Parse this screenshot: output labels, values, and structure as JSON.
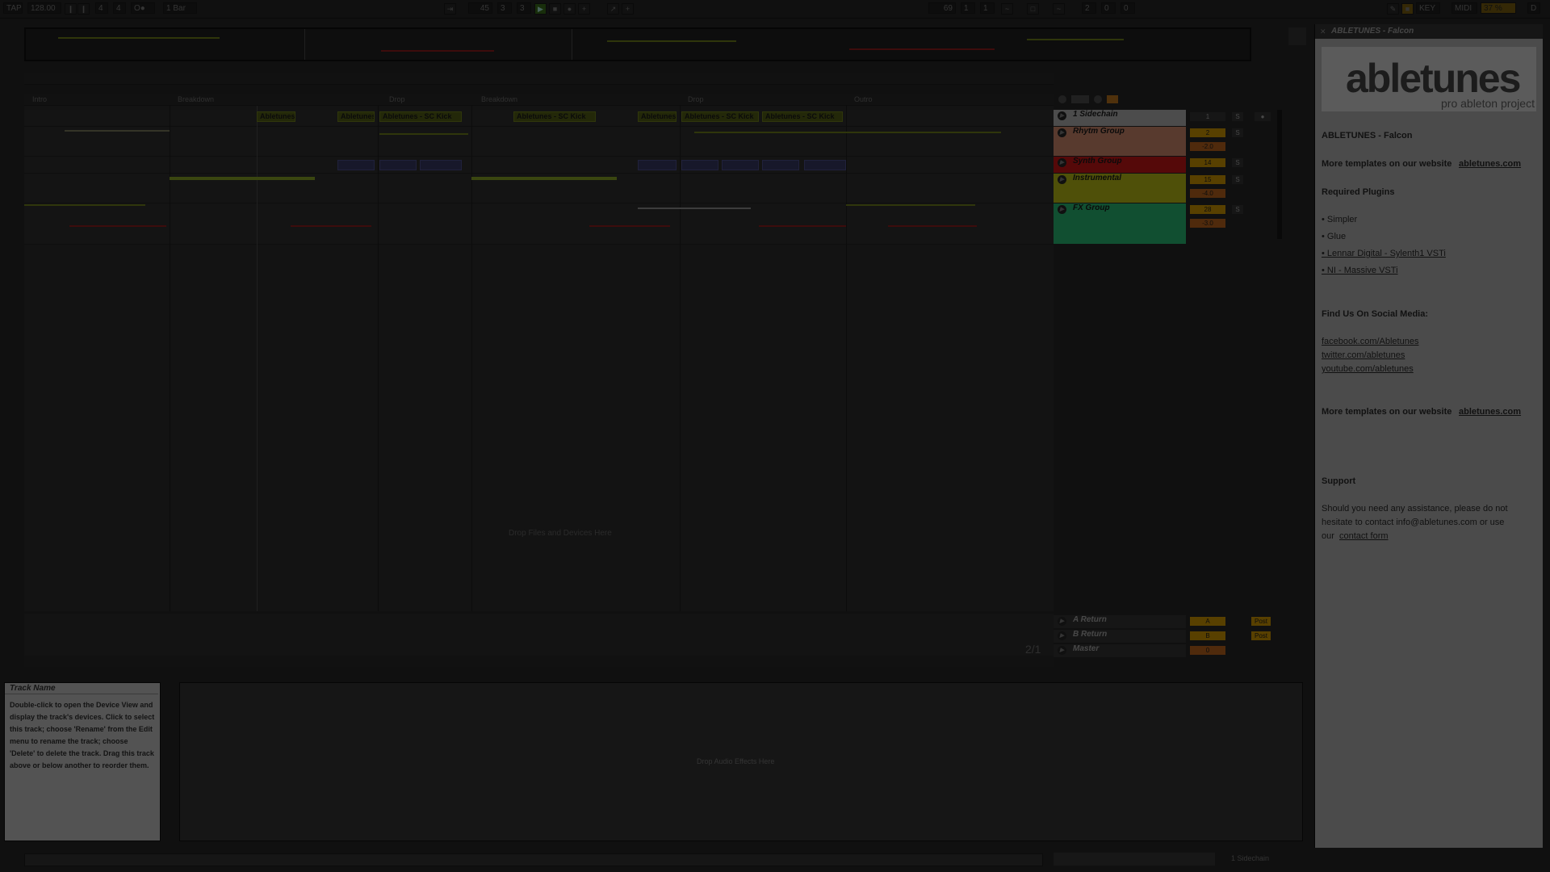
{
  "transport": {
    "tap": "TAP",
    "tempo": "128.00",
    "signature_num": "4",
    "signature_den": "4",
    "metronome": "O●",
    "quantize": "1 Bar",
    "position_bars": "45",
    "position_beats": "3",
    "position_sixteenths": "3",
    "loop_start": "69",
    "loop_start_beats": "1",
    "loop_start_six": "1",
    "loop_len": "2",
    "loop_len_beats": "0",
    "loop_len_six": "0",
    "key_label": "KEY",
    "midi_label": "MIDI",
    "cpu": "37 %",
    "disk": "D"
  },
  "locators": [
    "Intro",
    "Breakdown",
    "Drop",
    "Breakdown",
    "Drop",
    "Outro"
  ],
  "clips": {
    "clip1": "Abletunes",
    "clip2": "Abletunes",
    "clip3": "Abletunes - SC Kick",
    "clip4": "Abletunes - SC Kick",
    "clip5": "Abletunes",
    "clip6": "Abletunes - SC Kick",
    "clip7": "Abletunes - SC Kick"
  },
  "drop_files": "Drop Files and Devices Here",
  "tracks": [
    {
      "name": "1 Sidechain",
      "num": "1",
      "color": "#c9c9c9"
    },
    {
      "name": "Rhytm Group",
      "num": "2",
      "vol": "-2.0",
      "color": "#e89a7a"
    },
    {
      "name": "Synth Group",
      "num": "14",
      "color": "#e01818"
    },
    {
      "name": "Instrumental",
      "num": "15",
      "vol": "-4.0",
      "color": "#cfd21a"
    },
    {
      "name": "FX Group",
      "num": "28",
      "vol": "-3.0",
      "color": "#2fcf80"
    }
  ],
  "returns": [
    {
      "name": "A Return",
      "num": "A",
      "post": "Post"
    },
    {
      "name": "B Return",
      "num": "B",
      "post": "Post"
    },
    {
      "name": "Master",
      "num": "0"
    }
  ],
  "page_indicator": "2/1",
  "browser": {
    "title": "ABLETUNES - Falcon",
    "logo": "abletunes",
    "logo_sub": "pro ableton project",
    "heading": "ABLETUNES - Falcon",
    "more1": "More templates on our website",
    "more1_link": "abletunes.com",
    "required": "Required Plugins",
    "plugins": [
      "Simpler",
      "Glue",
      "Lennar Digital - Sylenth1 VSTi",
      "NI - Massive VSTi"
    ],
    "social_heading": "Find Us On Social Media:",
    "social": [
      "facebook.com/Abletunes",
      "twitter.com/abletunes",
      "youtube.com/abletunes"
    ],
    "more2": "More templates on our website",
    "more2_link": "abletunes.com",
    "support": "Support",
    "support_text1": "Should you need any assistance, please do not",
    "support_text2": "hesitate to contact info@abletunes.com or use",
    "support_text3": "our",
    "support_link": "contact form"
  },
  "info": {
    "title": "Track Name",
    "body": "Double-click to open the Device View and display the track's devices. Click to select this track; choose 'Rename' from the Edit menu to rename the track; choose 'Delete' to delete the track. Drag this track above or below another to reorder them."
  },
  "device_drop": "Drop Audio Effects Here",
  "status_track": "1 Sidechain",
  "colors": {
    "accent": "#f0a800",
    "clip_green": "#9ad22a",
    "clip_blue": "#6a6fd8"
  }
}
